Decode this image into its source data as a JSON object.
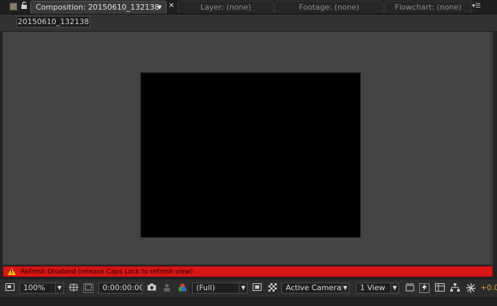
{
  "tabs": {
    "composition_label": "Composition: 20150610_132138",
    "layer_label": "Layer: (none)",
    "footage_label": "Footage: (none)",
    "flowchart_label": "Flowchart: (none)"
  },
  "navigator": {
    "comp_name": "20150610_132138"
  },
  "warning": {
    "text": "Refresh Disabled (release Caps Lock to refresh view)",
    "color": "#d81616"
  },
  "toolbar": {
    "magnification": "100%",
    "timecode": "0:00:00:00",
    "resolution": "(Full)",
    "camera": "Active Camera",
    "views": "1 View",
    "exposure_value": "+0.0"
  },
  "icons": {
    "lock": "lock-icon",
    "close": "close-icon",
    "panel_menu": "panel-menu-icon",
    "snapshot": "camera-snapshot-icon",
    "channels": "rgb-channels-icon",
    "grid": "transparency-grid-icon",
    "flowchart": "flowchart-icon"
  }
}
